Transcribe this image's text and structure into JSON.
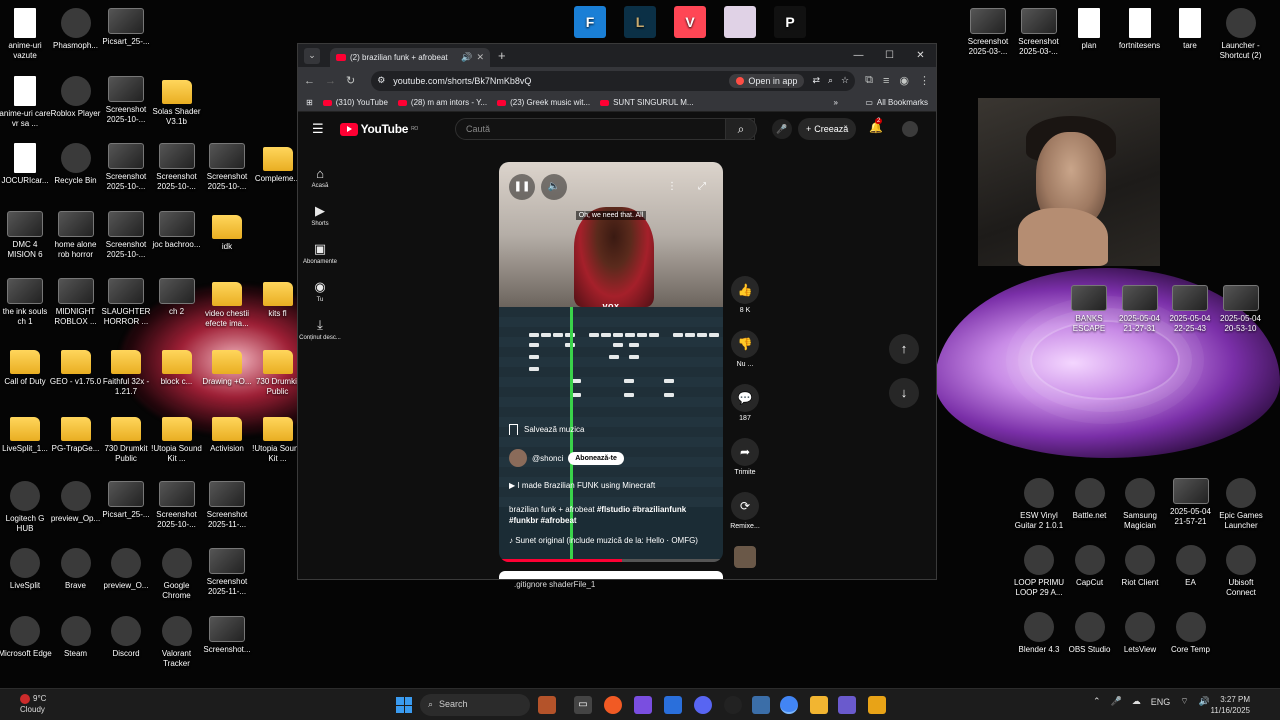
{
  "desktop": {
    "left_icons": [
      {
        "label": "anime-uri vazute",
        "kind": "doc",
        "x": 0,
        "y": 0
      },
      {
        "label": "Phasmoph...",
        "kind": "app",
        "x": 1,
        "y": 0
      },
      {
        "label": "Picsart_25-...",
        "kind": "shot",
        "x": 2,
        "y": 0
      },
      {
        "label": "anime-uri care vr sa ...",
        "kind": "doc",
        "x": 0,
        "y": 1
      },
      {
        "label": "Roblox Player",
        "kind": "app",
        "x": 1,
        "y": 1
      },
      {
        "label": "Screenshot 2025-10-...",
        "kind": "shot",
        "x": 2,
        "y": 1
      },
      {
        "label": "Solas Shader V3.1b",
        "kind": "folder",
        "x": 3,
        "y": 1
      },
      {
        "label": "JOCURIcar...",
        "kind": "doc",
        "x": 0,
        "y": 2
      },
      {
        "label": "Recycle Bin",
        "kind": "app",
        "x": 1,
        "y": 2
      },
      {
        "label": "Screenshot 2025-10-...",
        "kind": "shot",
        "x": 2,
        "y": 2
      },
      {
        "label": "Screenshot 2025-10-...",
        "kind": "shot",
        "x": 3,
        "y": 2
      },
      {
        "label": "Screenshot 2025-10-...",
        "kind": "shot",
        "x": 4,
        "y": 2
      },
      {
        "label": "Compleme...",
        "kind": "folder",
        "x": 5,
        "y": 2
      },
      {
        "label": "DMC 4 MISION 6",
        "kind": "shot",
        "x": 0,
        "y": 3
      },
      {
        "label": "home alone rob horror",
        "kind": "shot",
        "x": 1,
        "y": 3
      },
      {
        "label": "Screenshot 2025-10-...",
        "kind": "shot",
        "x": 2,
        "y": 3
      },
      {
        "label": "joc bachroo...",
        "kind": "shot",
        "x": 3,
        "y": 3
      },
      {
        "label": "idk",
        "kind": "folder",
        "x": 4,
        "y": 3
      },
      {
        "label": "the ink souls ch 1",
        "kind": "shot",
        "x": 0,
        "y": 4
      },
      {
        "label": "MIDNIGHT ROBLOX ...",
        "kind": "shot",
        "x": 1,
        "y": 4
      },
      {
        "label": "SLAUGHTER HORROR ...",
        "kind": "shot",
        "x": 2,
        "y": 4
      },
      {
        "label": "ch 2",
        "kind": "shot",
        "x": 3,
        "y": 4
      },
      {
        "label": "video chestii efecte ima...",
        "kind": "folder",
        "x": 4,
        "y": 4
      },
      {
        "label": "kits fl",
        "kind": "folder",
        "x": 5,
        "y": 4
      },
      {
        "label": "Call of Duty",
        "kind": "folder",
        "x": 0,
        "y": 5
      },
      {
        "label": "GEO - v1.75.0",
        "kind": "folder",
        "x": 1,
        "y": 5
      },
      {
        "label": "Faithful 32x - 1.21.7",
        "kind": "folder",
        "x": 2,
        "y": 5
      },
      {
        "label": "block c...",
        "kind": "folder",
        "x": 3,
        "y": 5
      },
      {
        "label": "Drawing +O...",
        "kind": "folder",
        "x": 4,
        "y": 5
      },
      {
        "label": "730 Drumkit Public",
        "kind": "folder",
        "x": 5,
        "y": 5
      },
      {
        "label": "LiveSplit_1...",
        "kind": "folder",
        "x": 0,
        "y": 6
      },
      {
        "label": "PG-TrapGe...",
        "kind": "folder",
        "x": 1,
        "y": 6
      },
      {
        "label": "730 Drumkit Public",
        "kind": "folder",
        "x": 2,
        "y": 6
      },
      {
        "label": "!Utopia Sound Kit ...",
        "kind": "folder",
        "x": 3,
        "y": 6
      },
      {
        "label": "Activision",
        "kind": "folder",
        "x": 4,
        "y": 6
      },
      {
        "label": "!Utopia Sound Kit ...",
        "kind": "folder",
        "x": 5,
        "y": 6
      },
      {
        "label": "Logitech G HUB",
        "kind": "app",
        "x": 0,
        "y": 7
      },
      {
        "label": "preview_Op...",
        "kind": "app",
        "x": 1,
        "y": 7
      },
      {
        "label": "Picsart_25-...",
        "kind": "shot",
        "x": 2,
        "y": 7
      },
      {
        "label": "Screenshot 2025-10-...",
        "kind": "shot",
        "x": 3,
        "y": 7
      },
      {
        "label": "Screenshot 2025-11-...",
        "kind": "shot",
        "x": 4,
        "y": 7
      },
      {
        "label": "LiveSplit",
        "kind": "app",
        "x": 0,
        "y": 8
      },
      {
        "label": "Brave",
        "kind": "app",
        "x": 1,
        "y": 8
      },
      {
        "label": "preview_O...",
        "kind": "app",
        "x": 2,
        "y": 8
      },
      {
        "label": "Google Chrome",
        "kind": "app",
        "x": 3,
        "y": 8
      },
      {
        "label": "Screenshot 2025-11-...",
        "kind": "shot",
        "x": 4,
        "y": 8
      },
      {
        "label": "Microsoft Edge",
        "kind": "app",
        "x": 0,
        "y": 9
      },
      {
        "label": "Steam",
        "kind": "app",
        "x": 1,
        "y": 9
      },
      {
        "label": "Discord",
        "kind": "app",
        "x": 2,
        "y": 9
      },
      {
        "label": "Valorant Tracker",
        "kind": "app",
        "x": 3,
        "y": 9
      },
      {
        "label": "Screenshot...",
        "kind": "shot",
        "x": 4,
        "y": 9
      }
    ],
    "right_icons_top": [
      {
        "label": "Screenshot 2025-03-...",
        "kind": "shot"
      },
      {
        "label": "Screenshot 2025-03-...",
        "kind": "shot"
      },
      {
        "label": "plan",
        "kind": "doc"
      },
      {
        "label": "fortnitesens",
        "kind": "doc"
      },
      {
        "label": "tare",
        "kind": "doc"
      },
      {
        "label": "Launcher - Shortcut (2)",
        "kind": "app"
      }
    ],
    "right_icons_mid": [
      {
        "label": "BANKS ESCAPE",
        "kind": "shot"
      },
      {
        "label": "2025-05-04 21-27-31",
        "kind": "shot"
      },
      {
        "label": "2025-05-04 22-25-43",
        "kind": "shot"
      },
      {
        "label": "2025-05-04 20-53-10",
        "kind": "shot"
      }
    ],
    "right_icons_bottom": [
      {
        "label": "ESW Vinyl Guitar 2 1.0.1",
        "kind": "app"
      },
      {
        "label": "Battle.net",
        "kind": "app"
      },
      {
        "label": "Samsung Magician",
        "kind": "app"
      },
      {
        "label": "2025-05-04 21-57-21",
        "kind": "shot"
      },
      {
        "label": "Epic Games Launcher",
        "kind": "app"
      },
      {
        "label": "LOOP PRIMU LOOP 29 A...",
        "kind": "app"
      },
      {
        "label": "CapCut",
        "kind": "app"
      },
      {
        "label": "Riot Client",
        "kind": "app"
      },
      {
        "label": "EA",
        "kind": "app"
      },
      {
        "label": "Ubisoft Connect",
        "kind": "app"
      },
      {
        "label": "Blender 4.3",
        "kind": "app"
      },
      {
        "label": "OBS Studio",
        "kind": "app"
      },
      {
        "label": "LetsView",
        "kind": "app"
      },
      {
        "label": "Core Temp",
        "kind": "app"
      }
    ]
  },
  "browser": {
    "tab_title": "(2) brazilian funk + afrobeat",
    "new_tab": "+",
    "url": "youtube.com/shorts/Bk7NmKb8vQ",
    "open_in_app": "Open in app",
    "bookmarks": [
      "(310) YouTube",
      "(28) m am intors - Y...",
      "(23) Greek music wit...",
      "SUNT SINGURUL M..."
    ],
    "all_bookmarks": "All Bookmarks"
  },
  "youtube": {
    "logo_text": "YouTube",
    "logo_region": "RO",
    "search_placeholder": "Caută",
    "create_label": "Creează",
    "notifications_count": "2",
    "sidebar": [
      {
        "label": "Acasă",
        "icon": "home-icon",
        "glyph": "⌂"
      },
      {
        "label": "Shorts",
        "icon": "shorts-icon",
        "glyph": "▶"
      },
      {
        "label": "Abonamente",
        "icon": "subscriptions-icon",
        "glyph": "▣"
      },
      {
        "label": "Tu",
        "icon": "user-icon",
        "glyph": "◉"
      },
      {
        "label": "Conținut desc...",
        "icon": "download-icon",
        "glyph": "⤓"
      }
    ],
    "video": {
      "caption": "Oh, we need that. All",
      "vox_label": "vox",
      "save_music": "Salvează muzica",
      "channel": "@shonci",
      "subscribe": "Abonează-te",
      "linked_video": "I made Brazilian FUNK using Minecraft",
      "description_plain": "brazilian funk + afrobeat",
      "description_tags": "#flstudio #brazilianfunk #funkbr #afrobeat",
      "sound": "Sunet original (include muzică de la: Hello · OMFG)",
      "progress": 0.55
    },
    "actions": [
      {
        "label": "8 K",
        "icon": "like-icon",
        "glyph": "👍"
      },
      {
        "label": "Nu ...",
        "icon": "dislike-icon",
        "glyph": "👎"
      },
      {
        "label": "187",
        "icon": "comment-icon",
        "glyph": "💬"
      },
      {
        "label": "Trimite",
        "icon": "share-icon",
        "glyph": "➦"
      },
      {
        "label": "Remixe...",
        "icon": "remix-icon",
        "glyph": "⟳"
      }
    ],
    "below_text": ".gitignore    shaderFile_1"
  },
  "taskbar": {
    "weather_temp": "9°C",
    "weather_desc": "Cloudy",
    "search_label": "Search",
    "language": "ENG",
    "time": "3:27 PM",
    "date": "11/16/2025"
  }
}
